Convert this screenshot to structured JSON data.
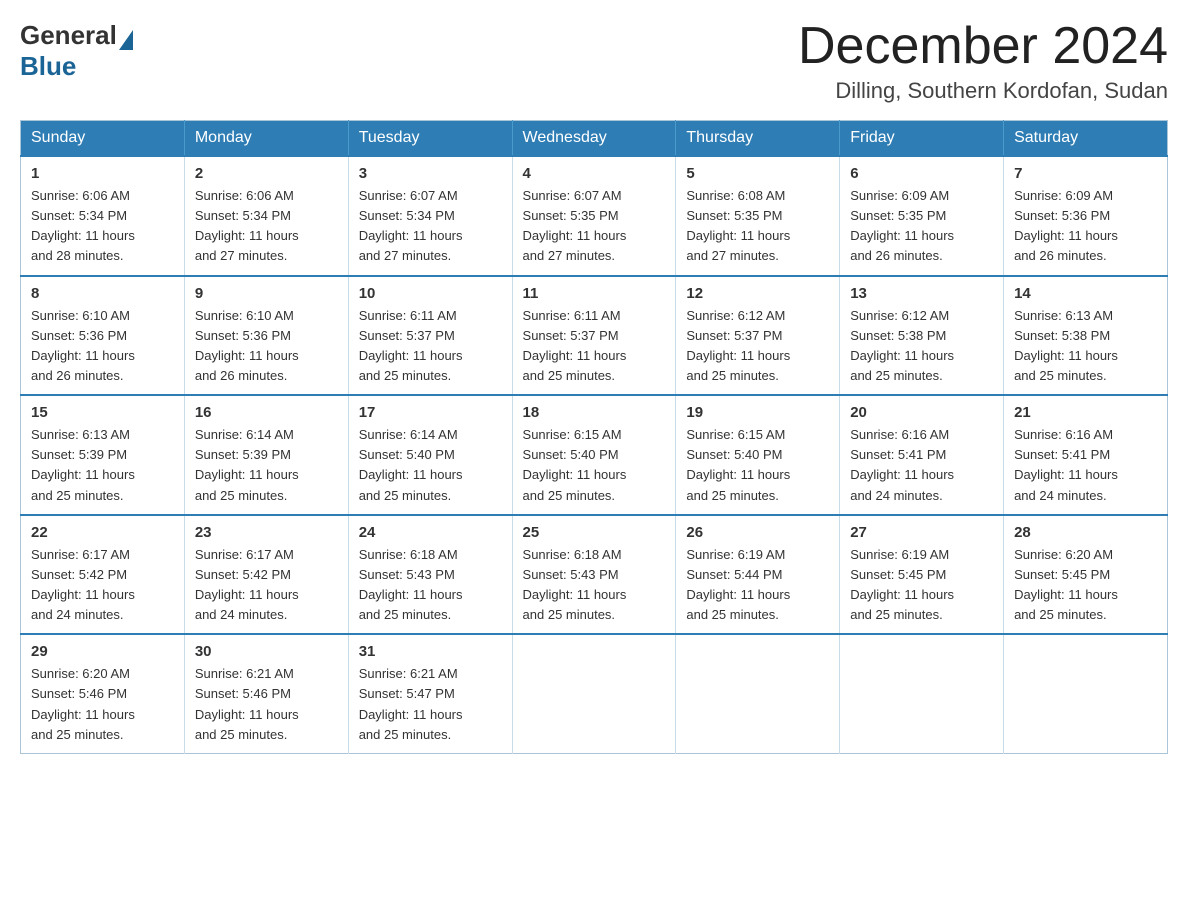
{
  "logo": {
    "text1": "General",
    "text2": "Blue"
  },
  "title": "December 2024",
  "location": "Dilling, Southern Kordofan, Sudan",
  "weekdays": [
    "Sunday",
    "Monday",
    "Tuesday",
    "Wednesday",
    "Thursday",
    "Friday",
    "Saturday"
  ],
  "weeks": [
    [
      {
        "day": "1",
        "sunrise": "6:06 AM",
        "sunset": "5:34 PM",
        "daylight": "11 hours and 28 minutes."
      },
      {
        "day": "2",
        "sunrise": "6:06 AM",
        "sunset": "5:34 PM",
        "daylight": "11 hours and 27 minutes."
      },
      {
        "day": "3",
        "sunrise": "6:07 AM",
        "sunset": "5:34 PM",
        "daylight": "11 hours and 27 minutes."
      },
      {
        "day": "4",
        "sunrise": "6:07 AM",
        "sunset": "5:35 PM",
        "daylight": "11 hours and 27 minutes."
      },
      {
        "day": "5",
        "sunrise": "6:08 AM",
        "sunset": "5:35 PM",
        "daylight": "11 hours and 27 minutes."
      },
      {
        "day": "6",
        "sunrise": "6:09 AM",
        "sunset": "5:35 PM",
        "daylight": "11 hours and 26 minutes."
      },
      {
        "day": "7",
        "sunrise": "6:09 AM",
        "sunset": "5:36 PM",
        "daylight": "11 hours and 26 minutes."
      }
    ],
    [
      {
        "day": "8",
        "sunrise": "6:10 AM",
        "sunset": "5:36 PM",
        "daylight": "11 hours and 26 minutes."
      },
      {
        "day": "9",
        "sunrise": "6:10 AM",
        "sunset": "5:36 PM",
        "daylight": "11 hours and 26 minutes."
      },
      {
        "day": "10",
        "sunrise": "6:11 AM",
        "sunset": "5:37 PM",
        "daylight": "11 hours and 25 minutes."
      },
      {
        "day": "11",
        "sunrise": "6:11 AM",
        "sunset": "5:37 PM",
        "daylight": "11 hours and 25 minutes."
      },
      {
        "day": "12",
        "sunrise": "6:12 AM",
        "sunset": "5:37 PM",
        "daylight": "11 hours and 25 minutes."
      },
      {
        "day": "13",
        "sunrise": "6:12 AM",
        "sunset": "5:38 PM",
        "daylight": "11 hours and 25 minutes."
      },
      {
        "day": "14",
        "sunrise": "6:13 AM",
        "sunset": "5:38 PM",
        "daylight": "11 hours and 25 minutes."
      }
    ],
    [
      {
        "day": "15",
        "sunrise": "6:13 AM",
        "sunset": "5:39 PM",
        "daylight": "11 hours and 25 minutes."
      },
      {
        "day": "16",
        "sunrise": "6:14 AM",
        "sunset": "5:39 PM",
        "daylight": "11 hours and 25 minutes."
      },
      {
        "day": "17",
        "sunrise": "6:14 AM",
        "sunset": "5:40 PM",
        "daylight": "11 hours and 25 minutes."
      },
      {
        "day": "18",
        "sunrise": "6:15 AM",
        "sunset": "5:40 PM",
        "daylight": "11 hours and 25 minutes."
      },
      {
        "day": "19",
        "sunrise": "6:15 AM",
        "sunset": "5:40 PM",
        "daylight": "11 hours and 25 minutes."
      },
      {
        "day": "20",
        "sunrise": "6:16 AM",
        "sunset": "5:41 PM",
        "daylight": "11 hours and 24 minutes."
      },
      {
        "day": "21",
        "sunrise": "6:16 AM",
        "sunset": "5:41 PM",
        "daylight": "11 hours and 24 minutes."
      }
    ],
    [
      {
        "day": "22",
        "sunrise": "6:17 AM",
        "sunset": "5:42 PM",
        "daylight": "11 hours and 24 minutes."
      },
      {
        "day": "23",
        "sunrise": "6:17 AM",
        "sunset": "5:42 PM",
        "daylight": "11 hours and 24 minutes."
      },
      {
        "day": "24",
        "sunrise": "6:18 AM",
        "sunset": "5:43 PM",
        "daylight": "11 hours and 25 minutes."
      },
      {
        "day": "25",
        "sunrise": "6:18 AM",
        "sunset": "5:43 PM",
        "daylight": "11 hours and 25 minutes."
      },
      {
        "day": "26",
        "sunrise": "6:19 AM",
        "sunset": "5:44 PM",
        "daylight": "11 hours and 25 minutes."
      },
      {
        "day": "27",
        "sunrise": "6:19 AM",
        "sunset": "5:45 PM",
        "daylight": "11 hours and 25 minutes."
      },
      {
        "day": "28",
        "sunrise": "6:20 AM",
        "sunset": "5:45 PM",
        "daylight": "11 hours and 25 minutes."
      }
    ],
    [
      {
        "day": "29",
        "sunrise": "6:20 AM",
        "sunset": "5:46 PM",
        "daylight": "11 hours and 25 minutes."
      },
      {
        "day": "30",
        "sunrise": "6:21 AM",
        "sunset": "5:46 PM",
        "daylight": "11 hours and 25 minutes."
      },
      {
        "day": "31",
        "sunrise": "6:21 AM",
        "sunset": "5:47 PM",
        "daylight": "11 hours and 25 minutes."
      },
      null,
      null,
      null,
      null
    ]
  ],
  "labels": {
    "sunrise": "Sunrise:",
    "sunset": "Sunset:",
    "daylight": "Daylight:"
  }
}
